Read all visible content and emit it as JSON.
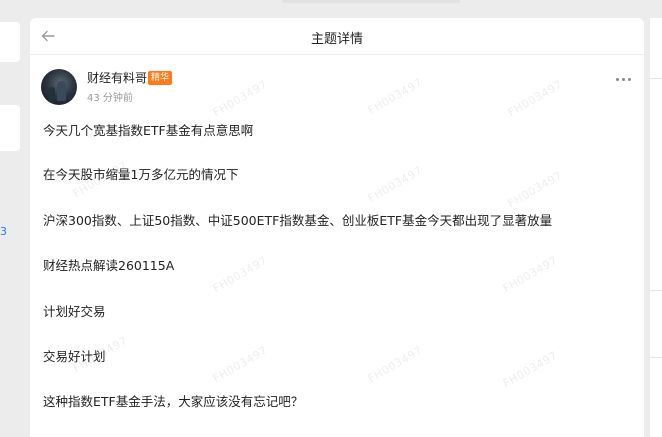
{
  "header": {
    "title": "主题详情"
  },
  "sidebar_left": {
    "count": "3"
  },
  "post": {
    "author": "财经有料哥",
    "badge": "精华",
    "time": "43 分钟前",
    "lines": [
      "今天几个宽基指数ETF基金有点意思啊",
      "在今天股市缩量1万多亿元的情况下",
      "沪深300指数、上证50指数、中证500ETF指数基金、创业板ETF基金今天都出现了显著放量",
      "财经热点解读260115A",
      "计划好交易",
      "交易好计划",
      "这种指数ETF基金手法，大家应该没有忘记吧？"
    ]
  },
  "watermark": {
    "text": "FH003497"
  },
  "icons": {
    "back": "back-arrow-icon",
    "more": "more-dots-icon"
  }
}
